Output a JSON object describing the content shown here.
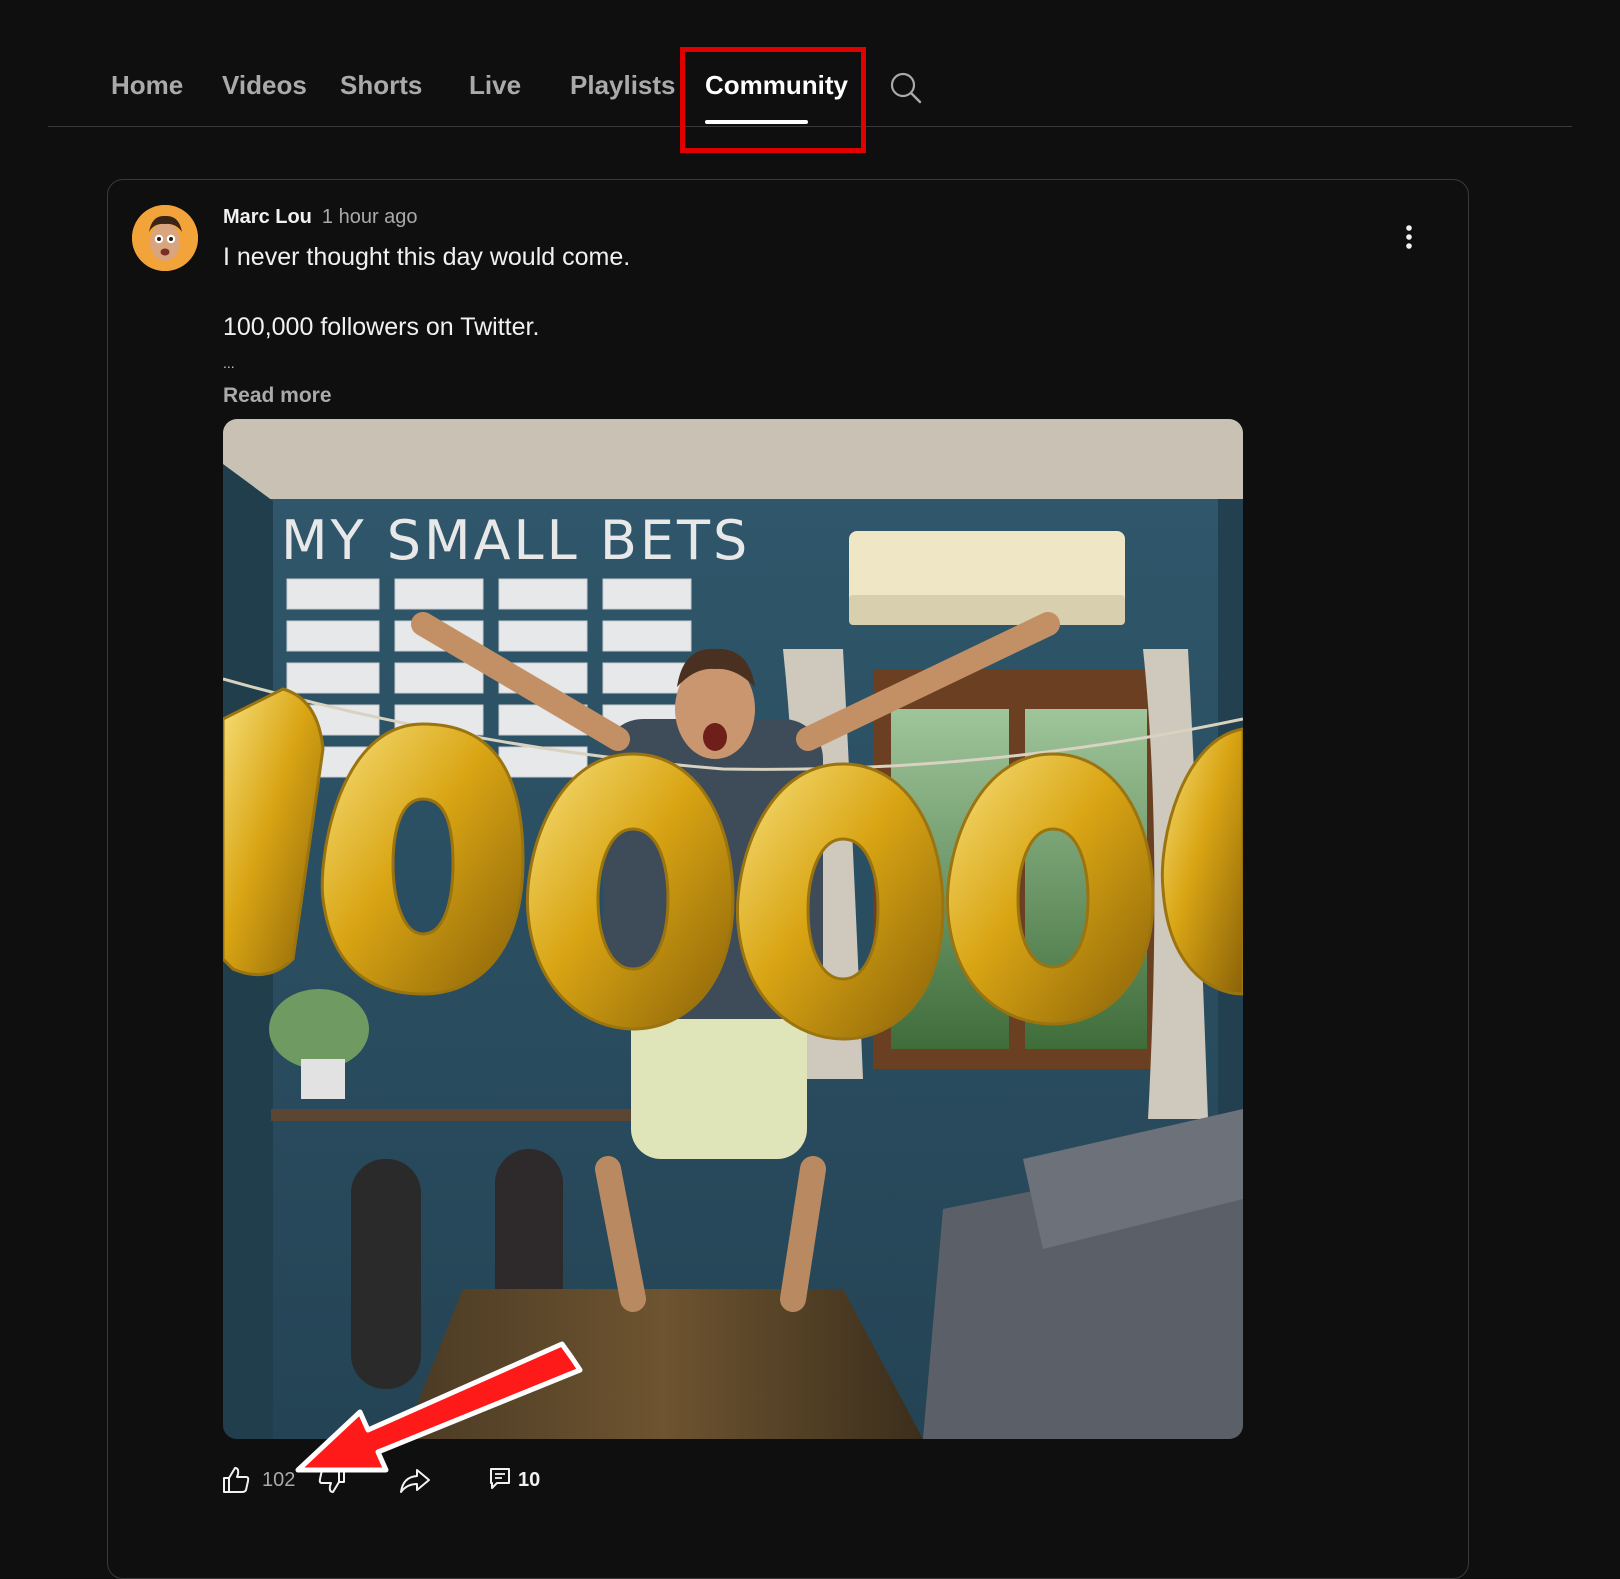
{
  "tabs": [
    {
      "label": "Home"
    },
    {
      "label": "Videos"
    },
    {
      "label": "Shorts"
    },
    {
      "label": "Live"
    },
    {
      "label": "Playlists"
    },
    {
      "label": "Community"
    }
  ],
  "active_tab": "Community",
  "post": {
    "author": "Marc Lou",
    "time": "1 hour ago",
    "lines": [
      "I never thought this day would come.",
      "100,000 followers on Twitter."
    ],
    "ellipsis": "...",
    "read_more": "Read more",
    "image": {
      "wall_text": "MY SMALL BETS"
    },
    "likes": "102",
    "comments": "10"
  },
  "colors": {
    "background": "#0f0f0f",
    "highlight": "#e00000",
    "arrow": "#ff1a1a",
    "balloon_gold": "#d9a514",
    "wall_blue": "#2e5468"
  },
  "icons": {
    "search": "search-icon",
    "more": "more-vert-icon",
    "like": "thumbs-up-icon",
    "dislike": "thumbs-down-icon",
    "share": "share-icon",
    "comment": "comment-icon"
  }
}
